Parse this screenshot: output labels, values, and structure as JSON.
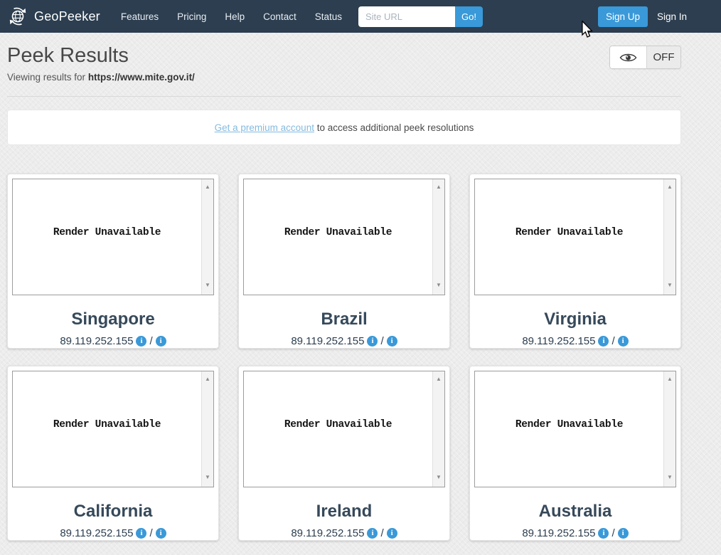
{
  "navbar": {
    "brand": "GeoPeeker",
    "items": [
      {
        "label": "Features"
      },
      {
        "label": "Pricing"
      },
      {
        "label": "Help"
      },
      {
        "label": "Contact"
      },
      {
        "label": "Status"
      }
    ],
    "search": {
      "placeholder": "Site URL",
      "go_label": "Go!"
    },
    "signup_label": "Sign Up",
    "signin_label": "Sign In"
  },
  "header": {
    "title": "Peek Results",
    "subtitle_prefix": "Viewing results for ",
    "url": "https://www.mite.gov.it/",
    "visibility_toggle": {
      "off_label": "OFF"
    }
  },
  "banner": {
    "link_text": "Get a premium account",
    "rest_text": " to access additional peek resolutions"
  },
  "results": {
    "render_status": "Render Unavailable",
    "ip_separator": "/",
    "locations": [
      {
        "name": "Singapore",
        "ip": "89.119.252.155"
      },
      {
        "name": "Brazil",
        "ip": "89.119.252.155"
      },
      {
        "name": "Virginia",
        "ip": "89.119.252.155"
      },
      {
        "name": "California",
        "ip": "89.119.252.155"
      },
      {
        "name": "Ireland",
        "ip": "89.119.252.155"
      },
      {
        "name": "Australia",
        "ip": "89.119.252.155"
      }
    ]
  },
  "colors": {
    "navbar_bg": "#2c3e50",
    "accent_blue": "#3a99d8",
    "link_blue": "#85bbdf",
    "page_bg": "#ececec",
    "heading_text": "#474747",
    "location_text": "#36495a"
  }
}
